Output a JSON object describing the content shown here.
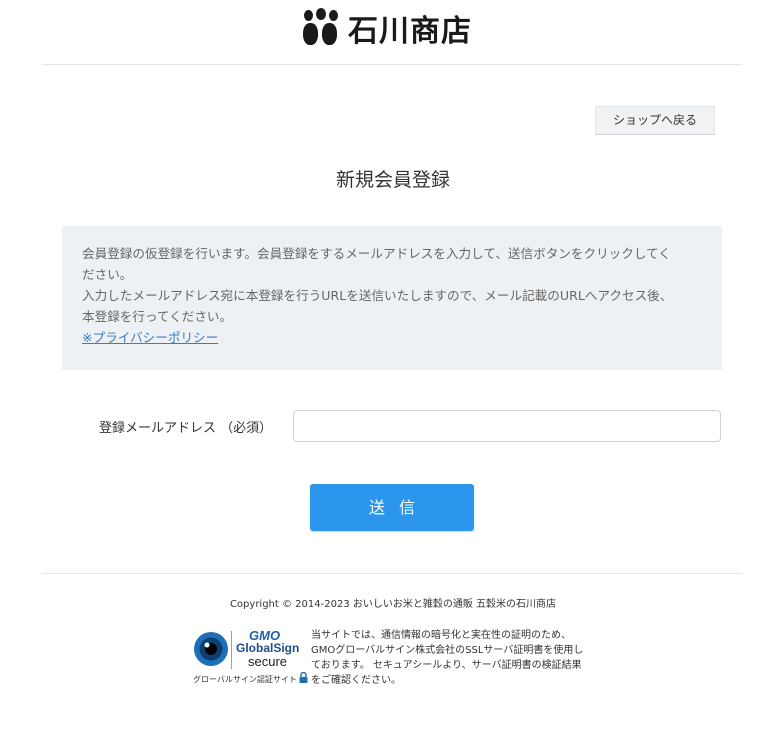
{
  "header": {
    "logo_text": "石川商店"
  },
  "nav": {
    "back_button": "ショップへ戻る"
  },
  "page": {
    "title": "新規会員登録"
  },
  "notice": {
    "line1": "会員登録の仮登録を行います。会員登録をするメールアドレスを入力して、送信ボタンをクリックしてく",
    "line2": "ださい。",
    "line3": "入力したメールアドレス宛に本登録を行うURLを送信いたしますので、メール記載のURLへアクセス後、",
    "line4": "本登録を行ってください。",
    "privacy_link": "※プライバシーポリシー"
  },
  "form": {
    "email_label": "登録メールアドレス （必須）",
    "email_value": "",
    "email_placeholder": "",
    "submit_label": "送信"
  },
  "footer": {
    "copyright": "Copyright © 2014-2023 おいしいお米と雑穀の通販 五穀米の石川商店",
    "seal": {
      "brand": "GMO",
      "name": "GlobalSign",
      "secure": "secure",
      "caption": "グローバルサイン認証サイト"
    },
    "seal_text": {
      "line1": "当サイトでは、通信情報の暗号化と実在性の証明のため、",
      "line2": "GMOグローバルサイン株式会社のSSLサーバ証明書を使用し",
      "line3": "ております。 セキュアシールより、サーバ証明書の検証結果",
      "line4": "をご確認ください。"
    }
  },
  "colors": {
    "submit": "#2b96eb",
    "notice_bg": "#edf1f4",
    "link": "#3a7cc7"
  }
}
